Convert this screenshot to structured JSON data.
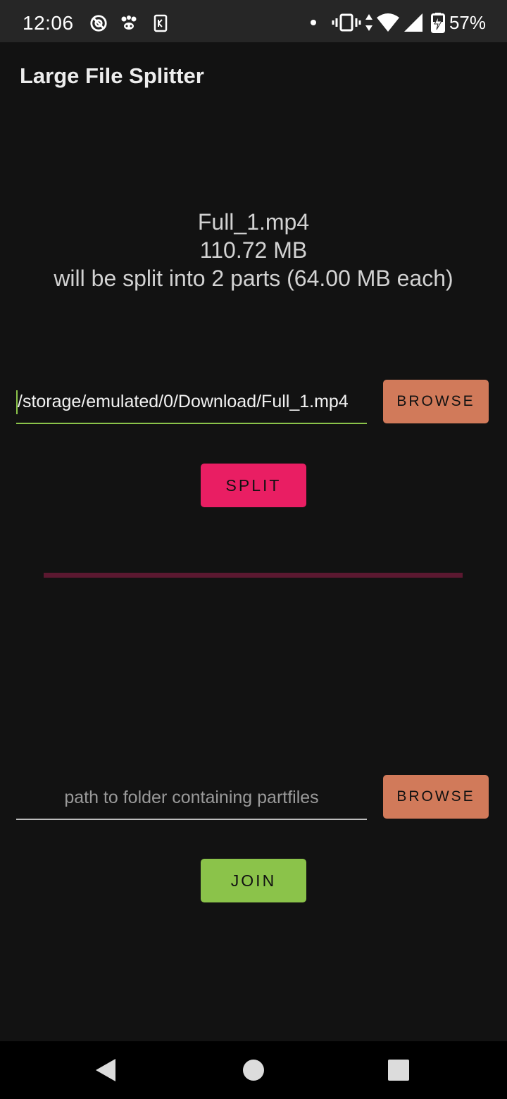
{
  "status_bar": {
    "time": "12:06",
    "battery": "57%",
    "left_icons": [
      "at-sign-icon",
      "paw-icon",
      "sim-card-icon"
    ],
    "right_icons": [
      "notification-dot-icon",
      "vibrate-icon",
      "data-arrows-icon",
      "wifi-icon",
      "signal-icon",
      "battery-charging-icon"
    ]
  },
  "app": {
    "title": "Large File Splitter"
  },
  "info": {
    "filename": "Full_1.mp4",
    "size": "110.72 MB",
    "split_description": "will be split into 2 parts (64.00 MB each)"
  },
  "split": {
    "path_value": "/storage/emulated/0/Download/Full_1.mp4",
    "browse_label": "BROWSE",
    "split_label": "SPLIT",
    "progress": 0
  },
  "join": {
    "path_placeholder": "path to folder containing partfiles",
    "browse_label": "BROWSE",
    "join_label": "JOIN"
  },
  "nav": {
    "icons": [
      "back-icon",
      "home-icon",
      "recents-icon"
    ]
  },
  "colors": {
    "accent_pink": "#e91e63",
    "accent_green": "#8bc34a",
    "browse_orange": "#d17a5a",
    "background": "#121212"
  }
}
